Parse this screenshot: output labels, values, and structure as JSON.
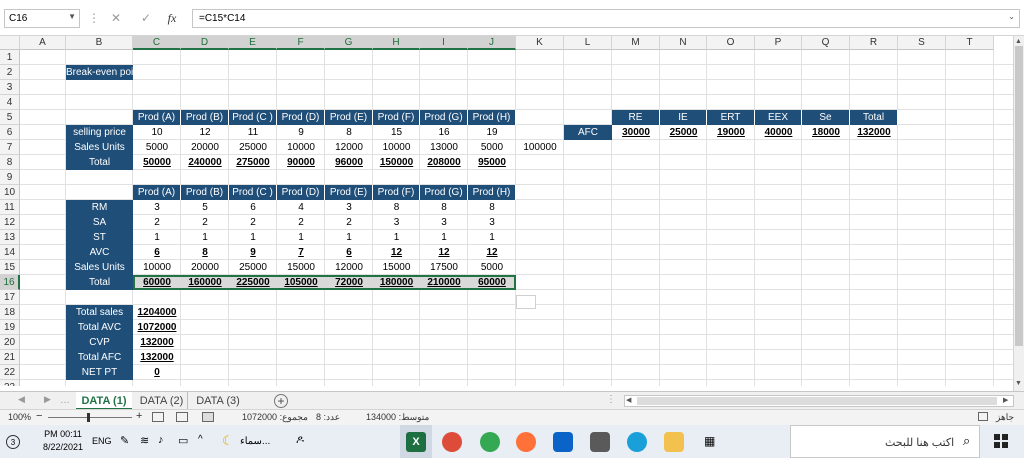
{
  "formula_bar": {
    "name_box": "C16",
    "formula": "=C15*C14",
    "cancel_glyph": "✕",
    "enter_glyph": "✓",
    "fx_glyph": "fx"
  },
  "columns": [
    "A",
    "B",
    "C",
    "D",
    "E",
    "F",
    "G",
    "H",
    "I",
    "J",
    "K",
    "L",
    "M",
    "N",
    "O",
    "P",
    "Q",
    "R",
    "S",
    "T"
  ],
  "rows": [
    "1",
    "2",
    "3",
    "4",
    "5",
    "6",
    "7",
    "8",
    "9",
    "10",
    "11",
    "12",
    "13",
    "14",
    "15",
    "16",
    "17",
    "18",
    "19",
    "20",
    "21",
    "22",
    "23"
  ],
  "title_cell": "Break-even point",
  "products": [
    "Prod (A)",
    "Prod (B)",
    "Prod (C )",
    "Prod (D)",
    "Prod (E)",
    "Prod (F)",
    "Prod (G)",
    "Prod (H)"
  ],
  "block1": {
    "labels": [
      "selling price",
      "Sales Units",
      "Total"
    ],
    "selling_price": [
      "10",
      "12",
      "11",
      "9",
      "8",
      "15",
      "16",
      "19"
    ],
    "sales_units": [
      "5000",
      "20000",
      "25000",
      "10000",
      "12000",
      "10000",
      "13000",
      "5000"
    ],
    "total": [
      "50000",
      "240000",
      "275000",
      "90000",
      "96000",
      "150000",
      "208000",
      "95000"
    ],
    "extra_k7": "100000"
  },
  "block2": {
    "labels": [
      "RM",
      "SA",
      "ST",
      "AVC",
      "Sales Units",
      "Total"
    ],
    "rm": [
      "3",
      "5",
      "6",
      "4",
      "3",
      "8",
      "8",
      "8"
    ],
    "sa": [
      "2",
      "2",
      "2",
      "2",
      "2",
      "3",
      "3",
      "3"
    ],
    "st": [
      "1",
      "1",
      "1",
      "1",
      "1",
      "1",
      "1",
      "1"
    ],
    "avc": [
      "6",
      "8",
      "9",
      "7",
      "6",
      "12",
      "12",
      "12"
    ],
    "sales_units": [
      "10000",
      "20000",
      "25000",
      "15000",
      "12000",
      "15000",
      "17500",
      "5000"
    ],
    "total": [
      "60000",
      "160000",
      "225000",
      "105000",
      "72000",
      "180000",
      "210000",
      "60000"
    ]
  },
  "afc_block": {
    "label": "AFC",
    "headers": [
      "RE",
      "IE",
      "ERT",
      "EEX",
      "Se",
      "Total"
    ],
    "values": [
      "30000",
      "25000",
      "19000",
      "40000",
      "18000",
      "132000"
    ]
  },
  "summary": {
    "labels": [
      "Total sales",
      "Total AVC",
      "CVP",
      "Total AFC",
      "NET PT"
    ],
    "values": [
      "1204000",
      "1072000",
      "132000",
      "132000",
      "0"
    ]
  },
  "sheet_tabs": [
    "DATA (1)",
    "DATA (2)",
    "DATA (3)"
  ],
  "status_bar": {
    "zoom": "100%",
    "average_label": "متوسط:",
    "average_value": "134000",
    "count_label": "عدد:",
    "count_value": "8",
    "sum_label": "مجموع:",
    "sum_value": "1072000",
    "ready": "جاهز"
  },
  "taskbar": {
    "time": "PM 00:11",
    "date": "8/22/2021",
    "lang": "ENG",
    "notification_count": "3",
    "weather_label": "سماء...",
    "search_placeholder": "اكتب هنا للبحث"
  },
  "colors": {
    "header_blue": "#1f4e79",
    "excel_green": "#217346"
  }
}
